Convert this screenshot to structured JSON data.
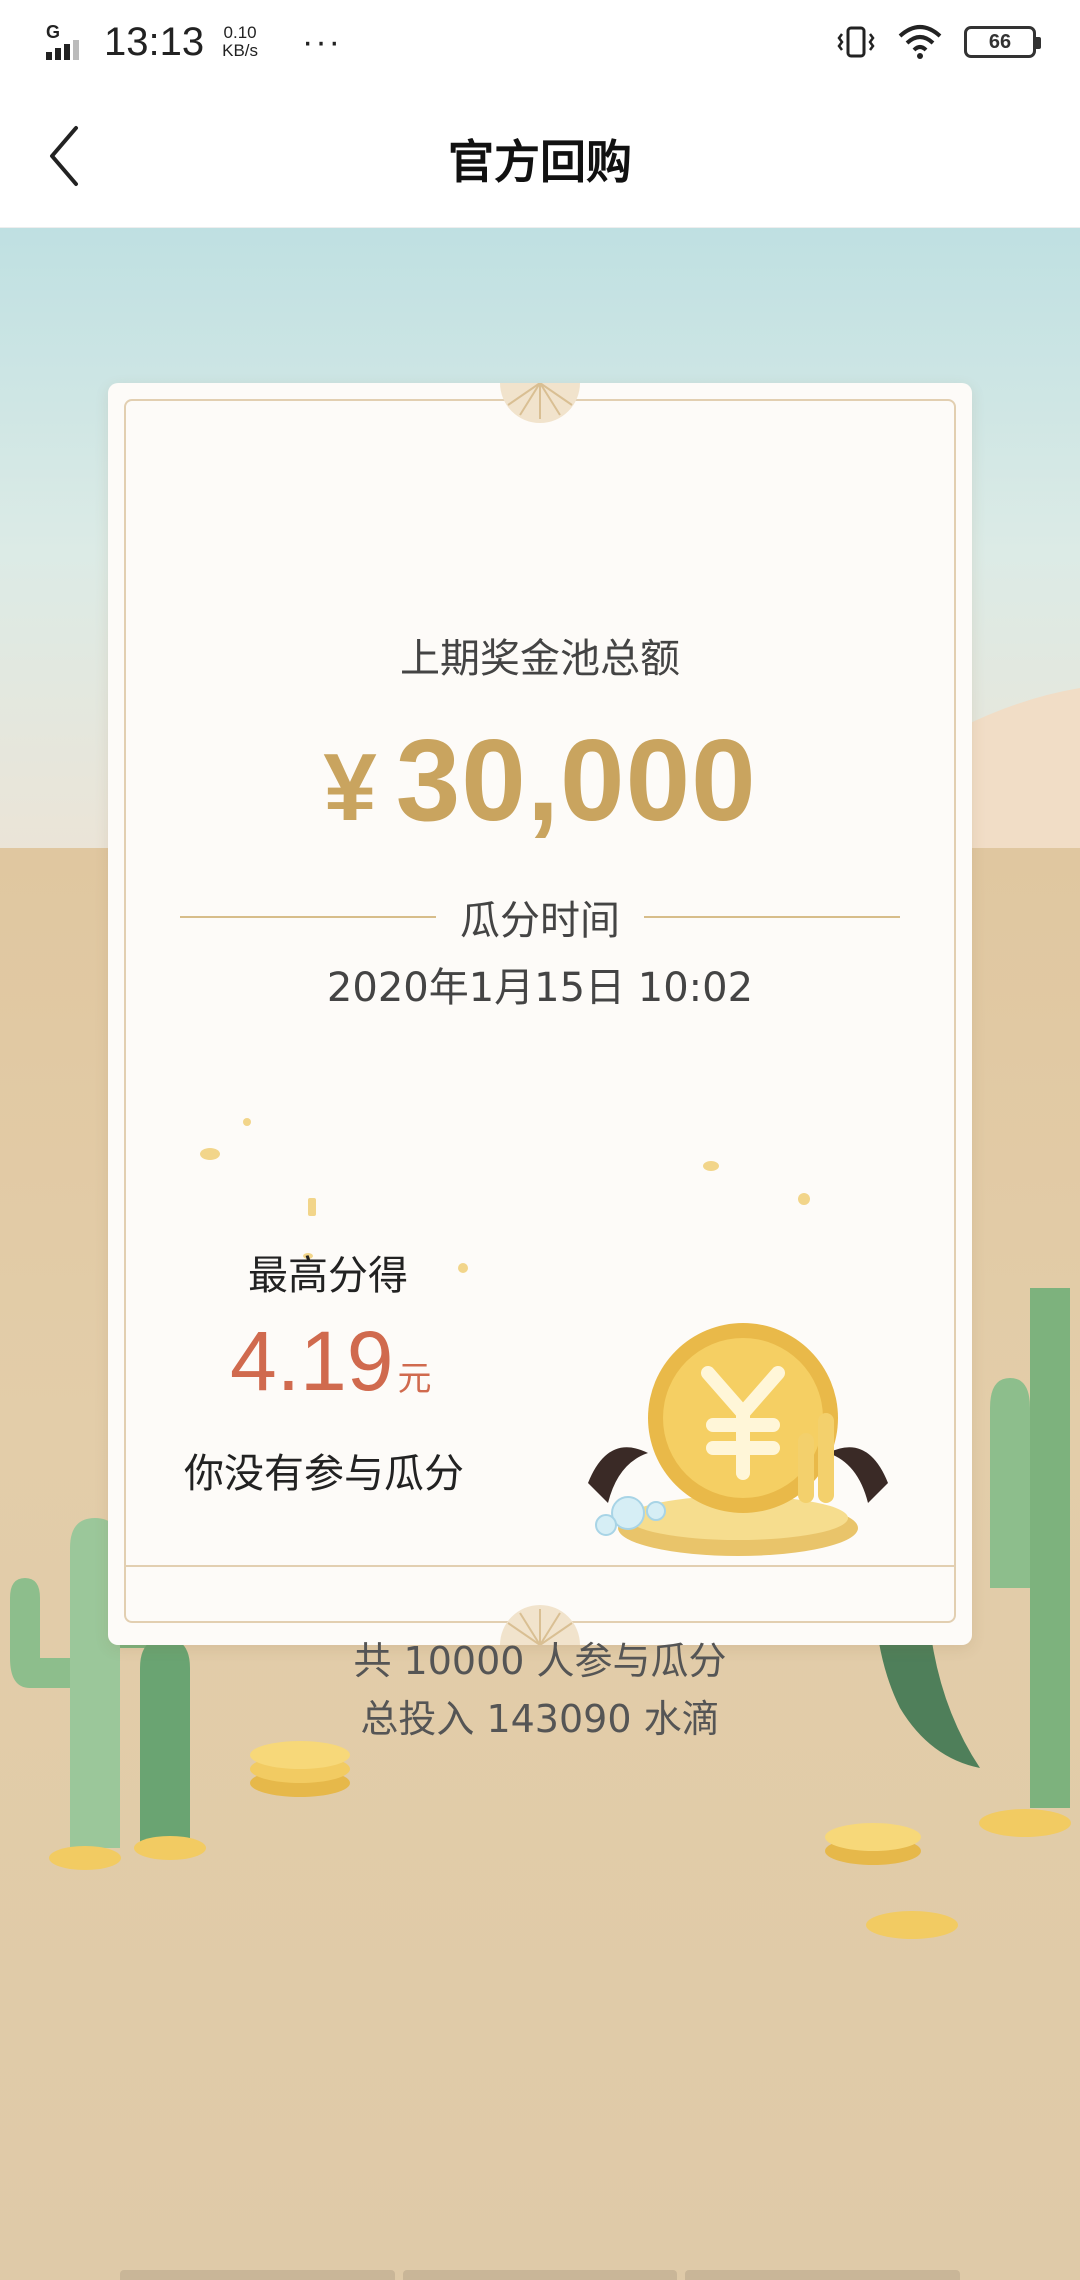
{
  "status_bar": {
    "network": "G",
    "time": "13:13",
    "speed_value": "0.10",
    "speed_unit": "KB/s",
    "more": "···",
    "battery": "66"
  },
  "nav": {
    "title": "官方回购"
  },
  "card": {
    "pool_label": "上期奖金池总额",
    "pool_currency": "¥",
    "pool_amount": "30,000",
    "split_time_label": "瓜分时间",
    "split_time": "2020年1月15日 10:02",
    "max_label": "最高分得",
    "max_value": "4.19",
    "max_unit": "元",
    "participation_status": "你没有参与瓜分",
    "participants_text": "共 10000 人参与瓜分",
    "total_input_text": "总投入 143090 水滴"
  },
  "colors": {
    "gold": "#c9a45f",
    "highlight_red": "#d06a4e",
    "card_border": "#e2cfb1"
  }
}
